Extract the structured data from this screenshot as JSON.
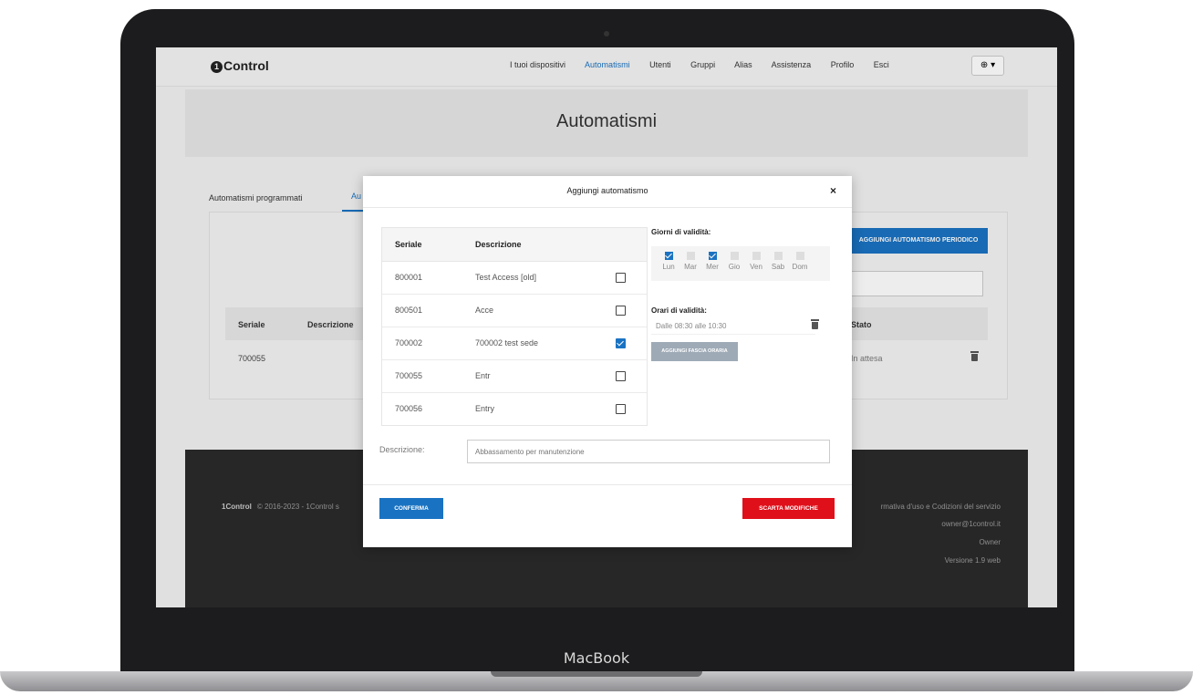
{
  "device": {
    "brand": "MacBook"
  },
  "app": {
    "logo": "Control",
    "logo_mark": "1",
    "nav": [
      "I tuoi dispositivi",
      "Automatismi",
      "Utenti",
      "Gruppi",
      "Alias",
      "Assistenza",
      "Profilo",
      "Esci"
    ],
    "lang_button": "⊕ ▾",
    "page_title": "Automatismi",
    "tabs": [
      "Automatismi programmati",
      "Au"
    ],
    "add_periodic_label": "AGGIUNGI AUTOMATISMO PERIODICO",
    "list": {
      "headers": {
        "serial": "Seriale",
        "description": "Descrizione",
        "status": "Stato"
      },
      "rows": [
        {
          "serial": "700055",
          "status": "In attesa"
        }
      ]
    },
    "footer": {
      "copyright": "© 2016-2023 - 1Control s",
      "links": "rmativa d'uso e Codizioni del servizio",
      "email": "owner@1control.it",
      "role": "Owner",
      "version": "Versione 1.9 web"
    }
  },
  "modal": {
    "title": "Aggiungi automatismo",
    "close": "×",
    "table": {
      "headers": {
        "serial": "Seriale",
        "description": "Descrizione"
      },
      "rows": [
        {
          "serial": "800001",
          "description": "Test Access [old]",
          "checked": false
        },
        {
          "serial": "800501",
          "description": "Acce",
          "checked": false
        },
        {
          "serial": "700002",
          "description": "700002 test sede",
          "checked": true
        },
        {
          "serial": "700055",
          "description": "Entr",
          "checked": false
        },
        {
          "serial": "700056",
          "description": "Entry",
          "checked": false
        }
      ]
    },
    "days_label": "Giorni di validità:",
    "days": [
      {
        "name": "Lun",
        "checked": true
      },
      {
        "name": "Mar",
        "checked": false
      },
      {
        "name": "Mer",
        "checked": true
      },
      {
        "name": "Gio",
        "checked": false
      },
      {
        "name": "Ven",
        "checked": false
      },
      {
        "name": "Sab",
        "checked": false
      },
      {
        "name": "Dom",
        "checked": false
      }
    ],
    "hours_label": "Orari di validità:",
    "slot": "Dalle 08:30 alle 10:30",
    "add_slot_label": "AGGIUNGI FASCIA ORARIA",
    "description_label": "Descrizione:",
    "description_placeholder": "Abbassamento per manutenzione",
    "confirm_label": "CONFERMA",
    "discard_label": "SCARTA MODIFICHE"
  },
  "colors": {
    "accent": "#1a73c2",
    "danger": "#e0101a"
  }
}
